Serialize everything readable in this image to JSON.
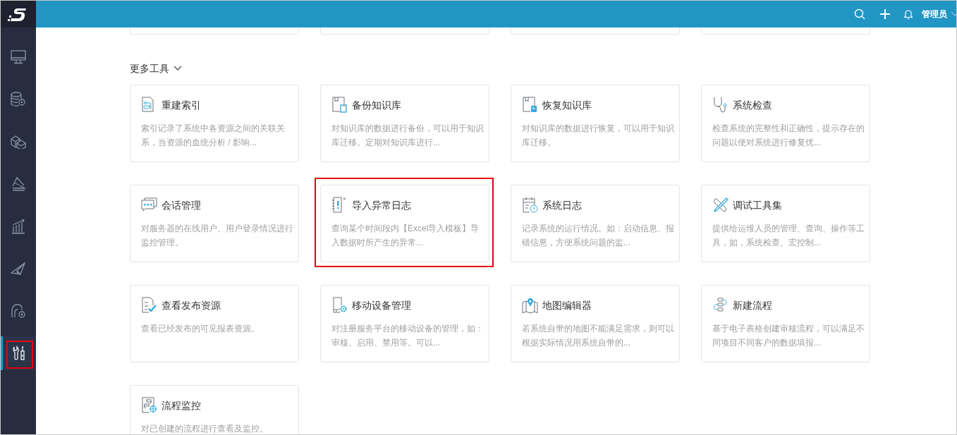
{
  "header": {
    "user": "管理员"
  },
  "sidebar": {
    "items": [
      {
        "selected": false,
        "highlighted": false
      },
      {
        "selected": false,
        "highlighted": false
      },
      {
        "selected": false,
        "highlighted": false
      },
      {
        "selected": false,
        "highlighted": false
      },
      {
        "selected": false,
        "highlighted": false
      },
      {
        "selected": false,
        "highlighted": false
      },
      {
        "selected": false,
        "highlighted": false
      },
      {
        "selected": true,
        "highlighted": true
      }
    ]
  },
  "section": {
    "title": "更多工具",
    "expanded": true
  },
  "cards": [
    {
      "title": "重建索引",
      "description": "索引记录了系统中各资源之间的关联关系，当资源的血统分析 / 影响...",
      "highlighted": false
    },
    {
      "title": "备份知识库",
      "description": "对知识库的数据进行备份，可以用于知识库迁移。定期对知识库进行...",
      "highlighted": false
    },
    {
      "title": "恢复知识库",
      "description": "对知识库的数据进行恢复，可以用于知识库迁移。",
      "highlighted": false
    },
    {
      "title": "系统检查",
      "description": "检查系统的完整性和正确性，提示存在的问题以便对系统进行修复优...",
      "highlighted": false
    },
    {
      "title": "会话管理",
      "description": "对服务器的在线用户、用户登录情况进行监控管理。",
      "highlighted": false
    },
    {
      "title": "导入异常日志",
      "description": "查询某个时间段内【Excel导入模板】导入数据时所产生的异常...",
      "highlighted": true
    },
    {
      "title": "系统日志",
      "description": "记录系统的运行情况。如：启动信息、报错信息，方便系统问题的监...",
      "highlighted": false
    },
    {
      "title": "调试工具集",
      "description": "提供给运维人员的管理、查询、操作等工具，如，系统检查、宏控制...",
      "highlighted": false
    },
    {
      "title": "查看发布资源",
      "description": "查看已经发布的可见报表资源。",
      "highlighted": false
    },
    {
      "title": "移动设备管理",
      "description": "对注册服务平台的移动设备的管理，如：审核、启用、禁用等。可以...",
      "highlighted": false
    },
    {
      "title": "地图编辑器",
      "description": "若系统自带的地图不能满足需求，则可以根据实际情况用系统自带的...",
      "highlighted": false
    },
    {
      "title": "新建流程",
      "description": "基于电子表格创建审核流程，可以满足不同项目不同客户的数据填报...",
      "highlighted": false
    },
    {
      "title": "流程监控",
      "description": "对已创建的流程进行查看及监控。",
      "highlighted": false
    }
  ]
}
